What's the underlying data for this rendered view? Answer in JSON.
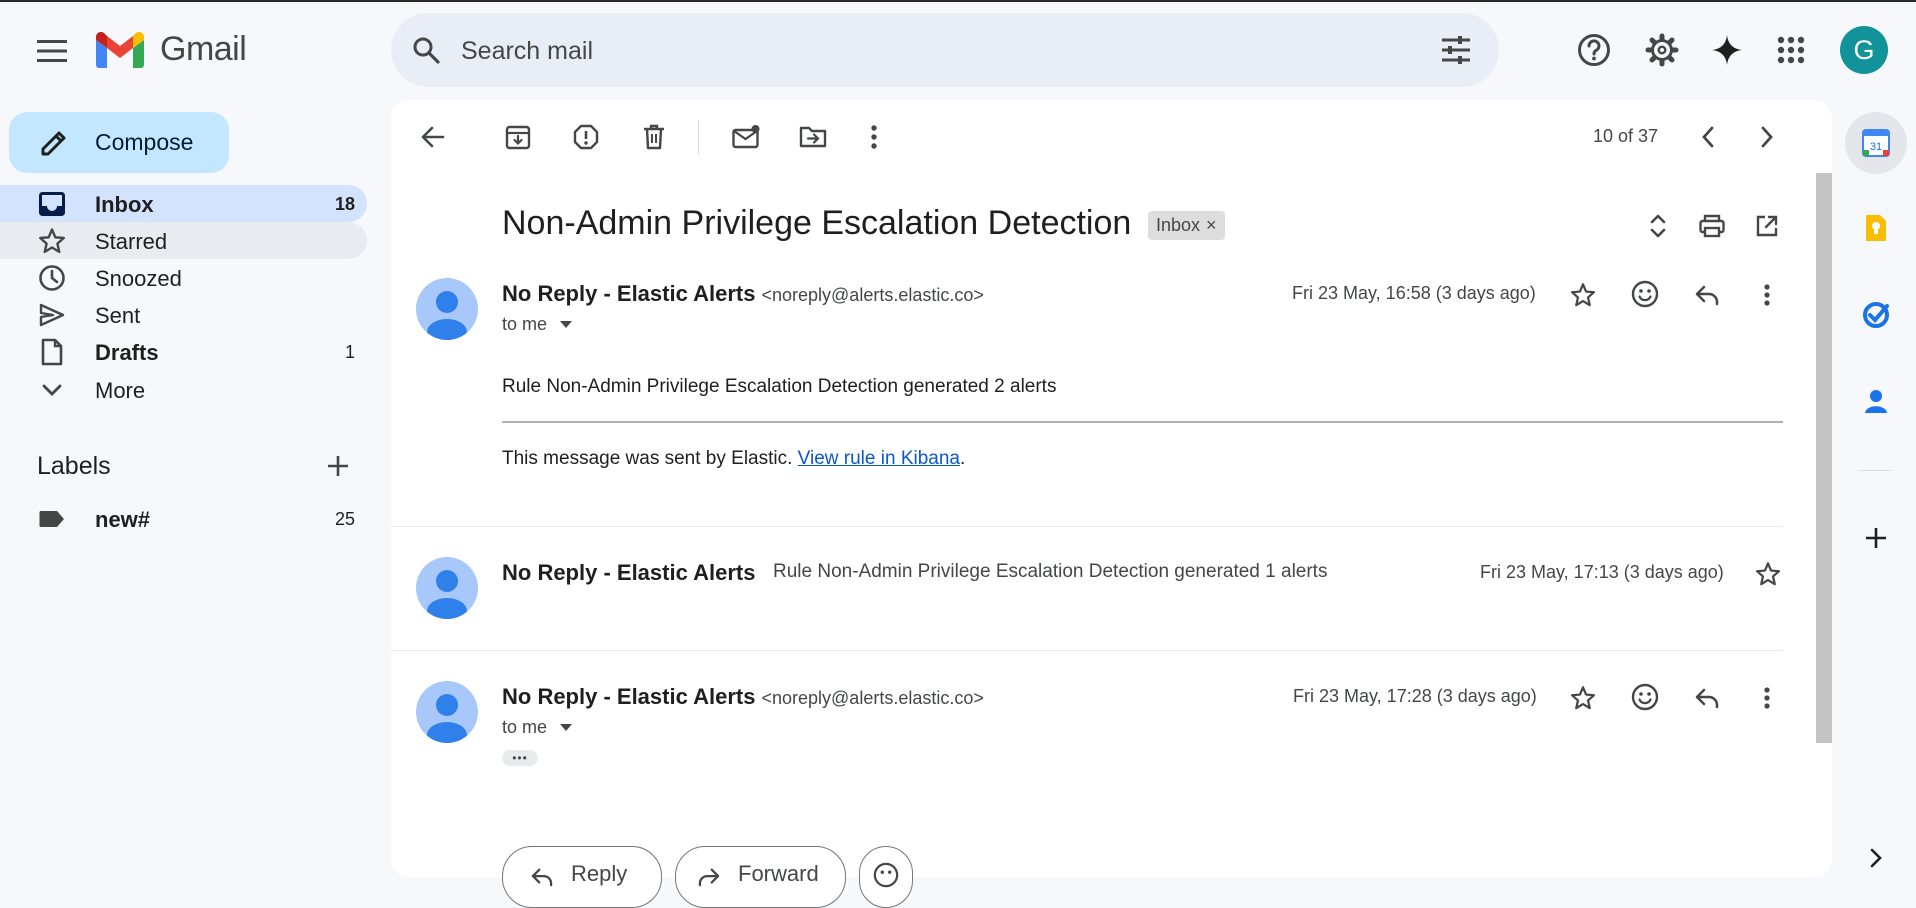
{
  "app": {
    "name": "Gmail"
  },
  "header": {
    "search_placeholder": "Search mail",
    "avatar_letter": "G",
    "icons": [
      "main-menu-icon",
      "gmail-logo",
      "search-icon",
      "search-options-icon",
      "help-icon",
      "settings-icon",
      "gemini-icon",
      "apps-icon"
    ]
  },
  "sidebar": {
    "compose_label": "Compose",
    "items": [
      {
        "label": "Inbox",
        "count": "18",
        "icon": "inbox-icon"
      },
      {
        "label": "Starred",
        "count": "",
        "icon": "star-icon"
      },
      {
        "label": "Snoozed",
        "count": "",
        "icon": "clock-icon"
      },
      {
        "label": "Sent",
        "count": "",
        "icon": "send-icon"
      },
      {
        "label": "Drafts",
        "count": "1",
        "icon": "draft-icon"
      },
      {
        "label": "More",
        "count": "",
        "icon": "chevron-down-icon"
      }
    ],
    "labels_title": "Labels",
    "labels": [
      {
        "label": "new#",
        "count": "25",
        "icon": "label-tag-icon"
      }
    ]
  },
  "toolbar": {
    "page_count": "10 of 37",
    "icons": [
      "back-arrow-icon",
      "archive-icon",
      "report-spam-icon",
      "delete-icon",
      "mark-unread-icon",
      "move-to-icon",
      "more-vert-icon",
      "newer-chevron-icon",
      "older-chevron-icon"
    ]
  },
  "thread": {
    "subject": "Non-Admin Privilege Escalation Detection",
    "chip_label": "Inbox",
    "chip_close": "×",
    "messages": [
      {
        "sender": "No Reply - Elastic Alerts",
        "email": "<noreply@alerts.elastic.co>",
        "to": "to me",
        "date": "Fri 23 May, 16:58 (3 days ago)",
        "body": "Rule Non-Admin Privilege Escalation Detection generated 2 alerts",
        "footer_text": "This message was sent by Elastic. ",
        "footer_link": "View rule in Kibana",
        "footer_end": "."
      },
      {
        "sender": "No Reply - Elastic Alerts",
        "snippet": "Rule Non-Admin Privilege Escalation Detection generated 1 alerts",
        "date": "Fri 23 May, 17:13 (3 days ago)"
      },
      {
        "sender": "No Reply - Elastic Alerts",
        "email": "<noreply@alerts.elastic.co>",
        "to": "to me",
        "date": "Fri 23 May, 17:28 (3 days ago)",
        "ellipsis": "•••"
      }
    ],
    "reply_label": "Reply",
    "forward_label": "Forward"
  },
  "right_sidebar": {
    "apps": [
      "calendar-icon",
      "keep-icon",
      "tasks-icon",
      "contacts-icon",
      "add-icon",
      "expand-chevron-icon"
    ],
    "calendar_day": "31"
  },
  "colors": {
    "background": "#f6f8fc",
    "compose": "#c2e7ff",
    "inbox_active": "#d3e3fd",
    "avatar": "#12939a",
    "link": "#0b57d0"
  }
}
